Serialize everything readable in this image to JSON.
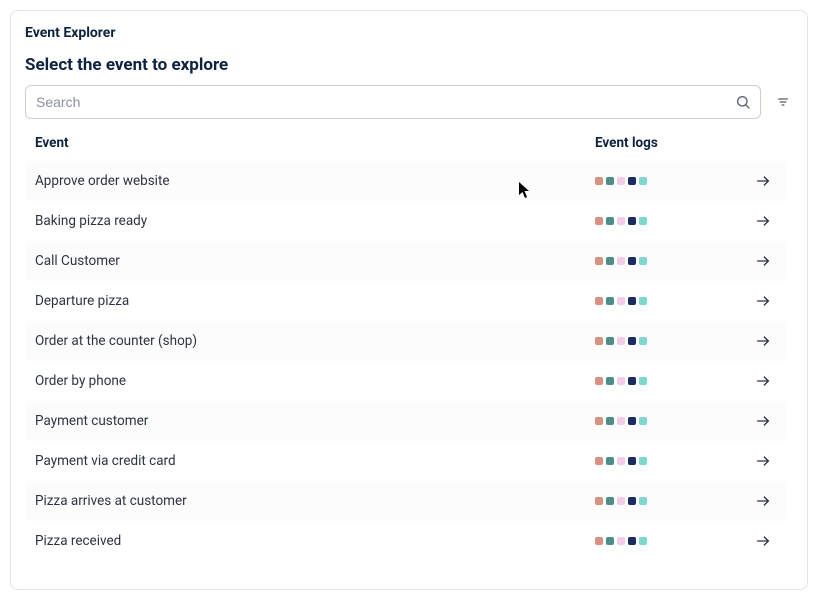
{
  "panel": {
    "title": "Event Explorer",
    "subtitle": "Select the event to explore"
  },
  "search": {
    "placeholder": "Search"
  },
  "columns": {
    "event": "Event",
    "logs": "Event logs"
  },
  "log_colors": [
    "#d89284",
    "#4e8e88",
    "#f0cfe6",
    "#1a2a62",
    "#7fd6d0"
  ],
  "events": [
    {
      "name": "Approve order website"
    },
    {
      "name": "Baking pizza ready"
    },
    {
      "name": "Call Customer"
    },
    {
      "name": "Departure pizza"
    },
    {
      "name": "Order at the counter (shop)"
    },
    {
      "name": "Order by phone"
    },
    {
      "name": "Payment customer"
    },
    {
      "name": "Payment via credit card"
    },
    {
      "name": "Pizza arrives at customer"
    },
    {
      "name": "Pizza received"
    }
  ]
}
